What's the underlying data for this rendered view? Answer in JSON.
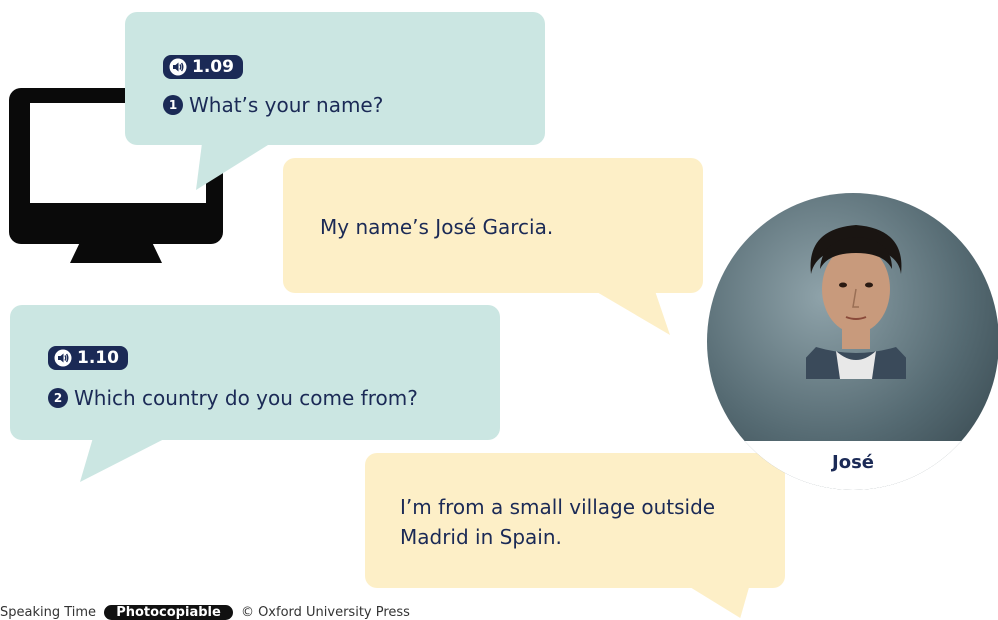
{
  "dialogue": [
    {
      "audio": "1.09",
      "number": "1",
      "question": "What’s your name?"
    },
    {
      "answer": "My name’s José Garcia."
    },
    {
      "audio": "1.10",
      "number": "2",
      "question": "Which country do you come from?"
    },
    {
      "answer": "I’m from a small village outside Madrid in Spain."
    }
  ],
  "person": {
    "name": "José"
  },
  "colors": {
    "question_bubble": "#cbe6e2",
    "answer_bubble": "#fdefc7",
    "navy": "#1b2a56"
  },
  "footer": {
    "left": "Speaking Time",
    "pill": "Photocopiable",
    "right": "© Oxford University Press"
  }
}
